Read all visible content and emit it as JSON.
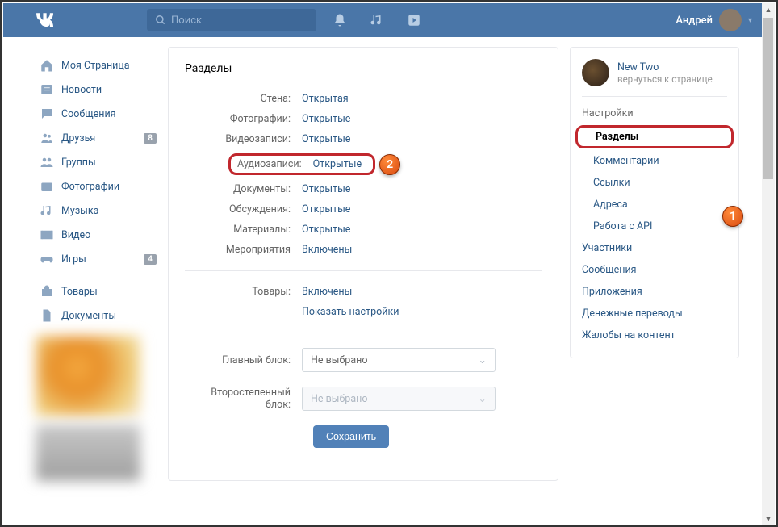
{
  "topbar": {
    "search_placeholder": "Поиск",
    "user_name": "Андрей"
  },
  "leftnav": {
    "items": [
      {
        "label": "Моя Страница",
        "icon": "home"
      },
      {
        "label": "Новости",
        "icon": "news"
      },
      {
        "label": "Сообщения",
        "icon": "chat"
      },
      {
        "label": "Друзья",
        "icon": "friends",
        "badge": "8"
      },
      {
        "label": "Группы",
        "icon": "groups"
      },
      {
        "label": "Фотографии",
        "icon": "photo"
      },
      {
        "label": "Музыка",
        "icon": "music"
      },
      {
        "label": "Видео",
        "icon": "video"
      },
      {
        "label": "Игры",
        "icon": "games",
        "badge": "4"
      }
    ],
    "items2": [
      {
        "label": "Товары",
        "icon": "bag"
      },
      {
        "label": "Документы",
        "icon": "doc"
      }
    ]
  },
  "main": {
    "title": "Разделы",
    "rows": [
      {
        "label": "Стена:",
        "value": "Открытая"
      },
      {
        "label": "Фотографии:",
        "value": "Открытые"
      },
      {
        "label": "Видеозаписи:",
        "value": "Открытые"
      },
      {
        "label": "Аудиозаписи:",
        "value": "Открытые"
      },
      {
        "label": "Документы:",
        "value": "Открытые"
      },
      {
        "label": "Обсуждения:",
        "value": "Открытые"
      },
      {
        "label": "Материалы:",
        "value": "Открытые"
      },
      {
        "label": "Мероприятия",
        "value": "Включены"
      }
    ],
    "goods_row": {
      "label": "Товары:",
      "value": "Включены"
    },
    "show_settings": "Показать настройки",
    "select1": {
      "label": "Главный блок:",
      "value": "Не выбрано"
    },
    "select2": {
      "label": "Второстепенный блок:",
      "value": "Не выбрано"
    },
    "save": "Сохранить"
  },
  "rightcol": {
    "page_name": "New Two",
    "page_sub": "вернуться к странице",
    "section1": "Настройки",
    "links1": [
      "Разделы",
      "Комментарии",
      "Ссылки",
      "Адреса",
      "Работа с API"
    ],
    "links2": [
      "Участники",
      "Сообщения",
      "Приложения",
      "Денежные переводы",
      "Жалобы на контент"
    ]
  },
  "callouts": {
    "c1": "1",
    "c2": "2"
  }
}
